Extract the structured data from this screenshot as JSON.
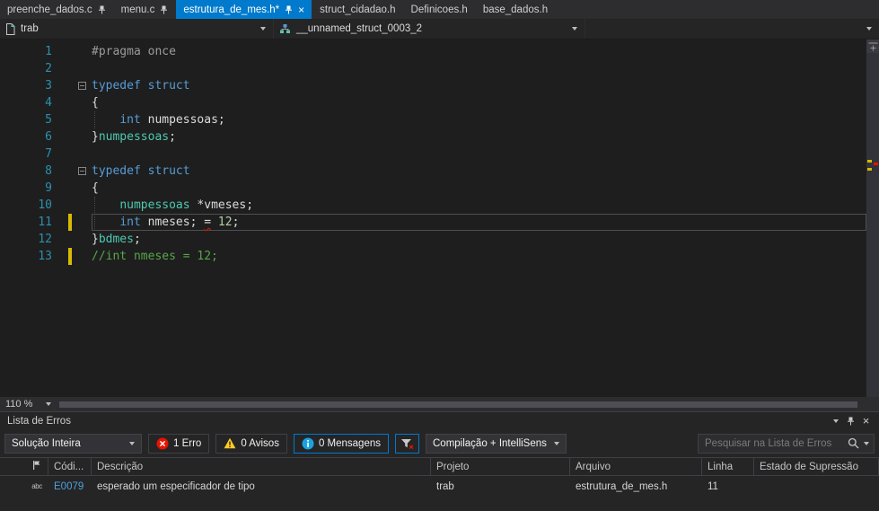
{
  "tab_bar": {
    "tabs": [
      {
        "label": "preenche_dados.c",
        "pin": true,
        "close": false,
        "active": false
      },
      {
        "label": "menu.c",
        "pin": true,
        "close": false,
        "active": false
      },
      {
        "label": "estrutura_de_mes.h*",
        "pin": true,
        "close": true,
        "active": true
      },
      {
        "label": "struct_cidadao.h",
        "pin": false,
        "close": false,
        "active": false
      },
      {
        "label": "Definicoes.h",
        "pin": false,
        "close": false,
        "active": false
      },
      {
        "label": "base_dados.h",
        "pin": false,
        "close": false,
        "active": false
      }
    ]
  },
  "nav_bar": {
    "project_scope": "trab",
    "type_scope": "__unnamed_struct_0003_2",
    "member_scope": ""
  },
  "editor": {
    "zoom_level": "110 %",
    "code_lines": [
      {
        "n": 1,
        "parts": [
          [
            "pp",
            "#pragma once"
          ]
        ]
      },
      {
        "n": 2,
        "parts": []
      },
      {
        "n": 3,
        "fold": true,
        "parts": [
          [
            "kw",
            "typedef struct"
          ]
        ]
      },
      {
        "n": 4,
        "parts": [
          [
            "pl",
            "{"
          ]
        ]
      },
      {
        "n": 5,
        "parts": [
          [
            "pl",
            "    "
          ],
          [
            "kw",
            "int"
          ],
          [
            "pl",
            " numpessoas;"
          ]
        ]
      },
      {
        "n": 6,
        "parts": [
          [
            "pl",
            "}"
          ],
          [
            "ty",
            "numpessoas"
          ],
          [
            "pl",
            ";"
          ]
        ]
      },
      {
        "n": 7,
        "parts": []
      },
      {
        "n": 8,
        "fold": true,
        "parts": [
          [
            "kw",
            "typedef struct"
          ]
        ]
      },
      {
        "n": 9,
        "parts": [
          [
            "pl",
            "{"
          ]
        ]
      },
      {
        "n": 10,
        "parts": [
          [
            "pl",
            "    "
          ],
          [
            "ty",
            "numpessoas"
          ],
          [
            "pl",
            " *vmeses;"
          ]
        ]
      },
      {
        "n": 11,
        "current": true,
        "changed": true,
        "parts": [
          [
            "pl",
            "    "
          ],
          [
            "kw",
            "int"
          ],
          [
            "pl",
            " nmeses; "
          ],
          [
            "er",
            "="
          ],
          [
            "pl",
            " "
          ],
          [
            "nm",
            "12"
          ],
          [
            "pl",
            ";"
          ]
        ]
      },
      {
        "n": 12,
        "parts": [
          [
            "pl",
            "}"
          ],
          [
            "ty",
            "bdmes"
          ],
          [
            "pl",
            ";"
          ]
        ]
      },
      {
        "n": 13,
        "changed": true,
        "parts": [
          [
            "cm",
            "//int nmeses = 12;"
          ]
        ]
      }
    ]
  },
  "error_list": {
    "title": "Lista de Erros",
    "toolbar": {
      "scope_dropdown": "Solução Inteira",
      "errors_toggle": "1 Erro",
      "warnings_toggle": "0 Avisos",
      "messages_toggle": "0 Mensagens",
      "source_dropdown": "Compilação + IntelliSens",
      "search_placeholder": "Pesquisar na Lista de Erros"
    },
    "columns": {
      "code": "Códi...",
      "description": "Descrição",
      "project": "Projeto",
      "file": "Arquivo",
      "line": "Linha",
      "suppression": "Estado de Supressão"
    },
    "rows": [
      {
        "code": "E0079",
        "description": "esperado um especificador de tipo",
        "project": "trab",
        "file": "estrutura_de_mes.h",
        "line": "11",
        "suppression": ""
      }
    ]
  }
}
